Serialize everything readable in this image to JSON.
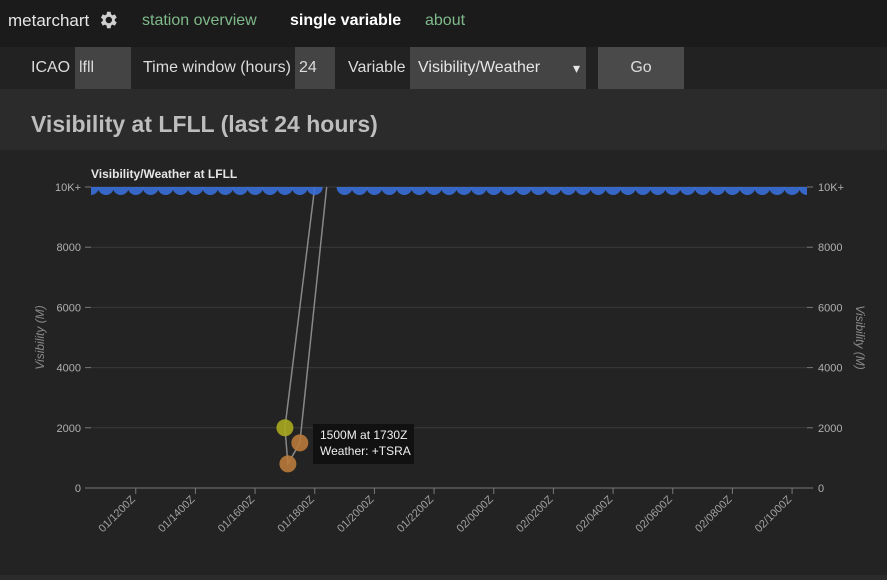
{
  "nav": {
    "brand": "metarchart",
    "links": [
      "station overview",
      "single variable",
      "about"
    ]
  },
  "controls": {
    "icao_label": "ICAO",
    "icao_value": "lfll",
    "window_label": "Time window (hours)",
    "window_value": "24",
    "variable_label": "Variable",
    "variable_selected": "Visibility/Weather",
    "go_label": "Go"
  },
  "page": {
    "title": "Visibility at LFLL (last 24 hours)"
  },
  "chart_data": {
    "type": "scatter",
    "title": "Visibility/Weather at LFLL",
    "ylabel": "Visibility (M)",
    "ylabel_right": "Visibility (M)",
    "ylim": [
      0,
      10000
    ],
    "yticks": [
      "0",
      "2000",
      "4000",
      "6000",
      "8000",
      "10K+"
    ],
    "xticks": [
      "01/1200Z",
      "01/1400Z",
      "01/1600Z",
      "01/1800Z",
      "01/2000Z",
      "01/2200Z",
      "02/0000Z",
      "02/0200Z",
      "02/0400Z",
      "02/0600Z",
      "02/0800Z",
      "02/1000Z"
    ],
    "x_range_hours": [
      -1.5,
      22.5
    ],
    "grid": true,
    "series": [
      {
        "color": "#3a6fd8",
        "points_hours": [
          -1.5,
          -1,
          -0.5,
          0,
          0.5,
          1,
          1.5,
          2,
          2.5,
          3,
          3.5,
          4,
          4.5,
          5,
          5.5,
          6,
          6,
          6.5,
          7,
          7.5,
          8,
          8.5,
          9,
          9.5,
          10,
          10.5,
          11,
          11.5,
          12,
          12.5,
          13,
          13.5,
          14,
          14.5,
          15,
          15.5,
          16,
          16.5,
          17,
          17.5,
          18,
          18.5,
          19,
          19.5,
          20,
          20.5,
          21,
          21.5,
          22,
          22.5
        ],
        "values": 10000
      },
      {
        "color": "#a8a820",
        "points": [
          {
            "h": 5.0,
            "y": 2000
          }
        ]
      },
      {
        "color": "#b87a3a",
        "points": [
          {
            "h": 5.1,
            "y": 800
          },
          {
            "h": 5.5,
            "y": 1500
          }
        ]
      }
    ],
    "tooltip": {
      "line1": "1500M at 1730Z",
      "line2": "Weather: +TSRA"
    }
  }
}
